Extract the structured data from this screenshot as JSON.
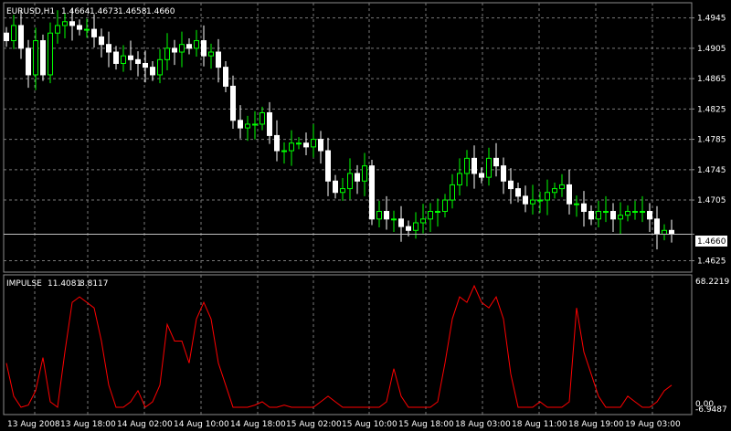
{
  "chart_data": [
    {
      "type": "candlestick",
      "title": "EURUSD,H1",
      "header_values": [
        "1.4664",
        "1.4673",
        "1.4658",
        "1.4660"
      ],
      "ylim": [
        1.461,
        1.4965
      ],
      "y_ticks": [
        "1.4945",
        "1.4905",
        "1.4865",
        "1.4825",
        "1.4785",
        "1.4745",
        "1.4705",
        "1.4660",
        "1.4625"
      ],
      "current_price": "1.4660",
      "x_ticks": [
        "13 Aug 2008",
        "13 Aug 18:00",
        "14 Aug 02:00",
        "14 Aug 10:00",
        "14 Aug 18:00",
        "15 Aug 02:00",
        "15 Aug 10:00",
        "15 Aug 18:00",
        "18 Aug 03:00",
        "18 Aug 11:00",
        "18 Aug 19:00",
        "19 Aug 03:00"
      ],
      "close": [
        1.4915,
        1.4935,
        1.4905,
        1.487,
        1.4915,
        1.487,
        1.4925,
        1.4935,
        1.494,
        1.4935,
        1.493,
        1.493,
        1.492,
        1.491,
        1.49,
        1.4885,
        1.4895,
        1.489,
        1.4885,
        1.488,
        1.487,
        1.489,
        1.4905,
        1.49,
        1.491,
        1.4905,
        1.4915,
        1.4895,
        1.49,
        1.488,
        1.4855,
        1.481,
        1.48,
        1.4805,
        1.4805,
        1.482,
        1.479,
        1.477,
        1.477,
        1.478,
        1.478,
        1.4775,
        1.4785,
        1.477,
        1.473,
        1.4715,
        1.472,
        1.474,
        1.473,
        1.475,
        1.468,
        1.469,
        1.468,
        1.468,
        1.467,
        1.4665,
        1.4675,
        1.468,
        1.469,
        1.469,
        1.4705,
        1.4725,
        1.474,
        1.476,
        1.474,
        1.4735,
        1.476,
        1.475,
        1.473,
        1.472,
        1.471,
        1.47,
        1.4705,
        1.4705,
        1.4715,
        1.472,
        1.4725,
        1.47,
        1.47,
        1.469,
        1.468,
        1.469,
        1.469,
        1.468,
        1.4685,
        1.469,
        1.469,
        1.469,
        1.468,
        1.466,
        1.4665,
        1.466
      ],
      "candle_colors": {
        "bull": "#00ff00",
        "bear": "#ffffff"
      },
      "background": "#000000"
    },
    {
      "type": "line",
      "title": "IMPULSE",
      "header_values": [
        "11.4081",
        "8.8117"
      ],
      "y_ticks": [
        "68.2219",
        "0.00",
        "-6.9487"
      ],
      "ylim": [
        -6.9487,
        68.2219
      ],
      "series": [
        {
          "color": "#ff0000",
          "values": [
            40,
            10,
            0,
            2,
            15,
            45,
            5,
            0,
            50,
            95,
            100,
            95,
            90,
            60,
            20,
            0,
            0,
            5,
            15,
            0,
            5,
            20,
            75,
            60,
            60,
            40,
            80,
            95,
            80,
            40,
            20,
            0,
            0,
            0,
            2,
            5,
            0,
            0,
            2,
            0,
            0,
            0,
            0,
            5,
            10,
            5,
            0,
            0,
            0,
            0,
            0,
            0,
            5,
            35,
            10,
            0,
            0,
            0,
            0,
            5,
            40,
            80,
            100,
            95,
            110,
            95,
            90,
            100,
            80,
            30,
            0,
            0,
            0,
            5,
            0,
            0,
            0,
            5,
            90,
            50,
            30,
            10,
            0,
            0,
            0,
            10,
            5,
            0,
            0,
            5,
            15,
            20
          ]
        }
      ]
    }
  ]
}
